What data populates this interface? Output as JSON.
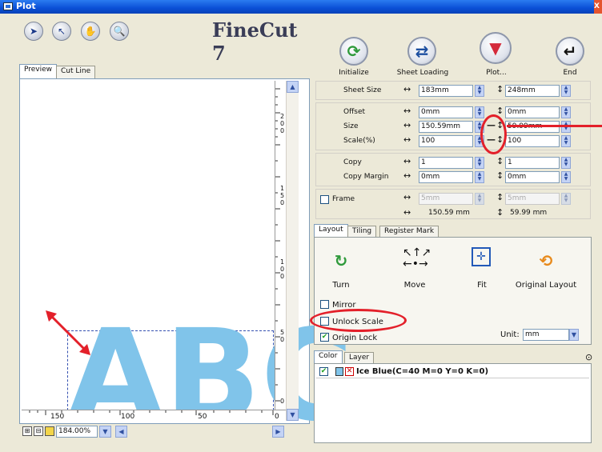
{
  "window": {
    "title": "Plot",
    "close_label": "X"
  },
  "toolbar": {
    "tools": [
      {
        "name": "select-arrow",
        "glyph": "➤"
      },
      {
        "name": "direct-select-arrow",
        "glyph": "↖"
      },
      {
        "name": "hand-tool",
        "glyph": "✋"
      },
      {
        "name": "zoom-tool",
        "glyph": "🔍"
      }
    ],
    "brand": "FineCut 7"
  },
  "preview_tabs": [
    {
      "label": "Preview"
    },
    {
      "label": "Cut Line"
    }
  ],
  "preview": {
    "letters": "ABC",
    "letter_color": "#80c4ea",
    "vruler_labels": [
      "2",
      "0",
      "0",
      "1",
      "5",
      "0",
      "1",
      "0",
      "0",
      "5",
      "0",
      "0"
    ],
    "hruler_labels": [
      "150",
      "100",
      "50",
      "0"
    ],
    "zoom_value": "184.00%"
  },
  "actions": [
    {
      "label": "Initialize",
      "icon": "refresh-icon",
      "glyph": "⟳",
      "color": "#2f9a3b"
    },
    {
      "label": "Sheet Loading",
      "icon": "sheet-loading-icon",
      "glyph": "⇄",
      "color": "#1d4fa0"
    },
    {
      "label": "Plot...",
      "icon": "plot-icon",
      "glyph": "▼",
      "color": "#d42a3b"
    },
    {
      "label": "End",
      "icon": "end-icon",
      "glyph": "↵",
      "color": "#222"
    }
  ],
  "settings": {
    "sheet_size": {
      "label": "Sheet Size",
      "w": "183mm",
      "h": "248mm"
    },
    "offset": {
      "label": "Offset",
      "w": "0mm",
      "h": "0mm"
    },
    "size": {
      "label": "Size",
      "w": "150.59mm",
      "h": "59.99mm"
    },
    "scale": {
      "label": "Scale(%)",
      "w": "100",
      "h": "100"
    },
    "copy": {
      "label": "Copy",
      "w": "1",
      "h": "1"
    },
    "copy_margin": {
      "label": "Copy Margin",
      "w": "0mm",
      "h": "0mm"
    },
    "frame": {
      "label": "Frame",
      "w": "5mm",
      "h": "5mm"
    },
    "totals": {
      "w": "150.59 mm",
      "h": "59.99 mm"
    }
  },
  "layout_tabs": [
    {
      "label": "Layout"
    },
    {
      "label": "Tiling"
    },
    {
      "label": "Register Mark"
    }
  ],
  "layout": {
    "turn": "Turn",
    "move": "Move",
    "fit": "Fit",
    "original": "Original Layout",
    "mirror": "Mirror",
    "unlock_scale": "Unlock Scale",
    "origin_lock": "Origin Lock",
    "unit_label": "Unit:",
    "unit_value": "mm"
  },
  "color_tabs": [
    {
      "label": "Color"
    },
    {
      "label": "Layer"
    }
  ],
  "color_list": [
    {
      "name": "Ice Blue(C=40 M=0 Y=0 K=0)",
      "swatch": "#80c4ea"
    }
  ],
  "annotation_color": "#e3202a"
}
